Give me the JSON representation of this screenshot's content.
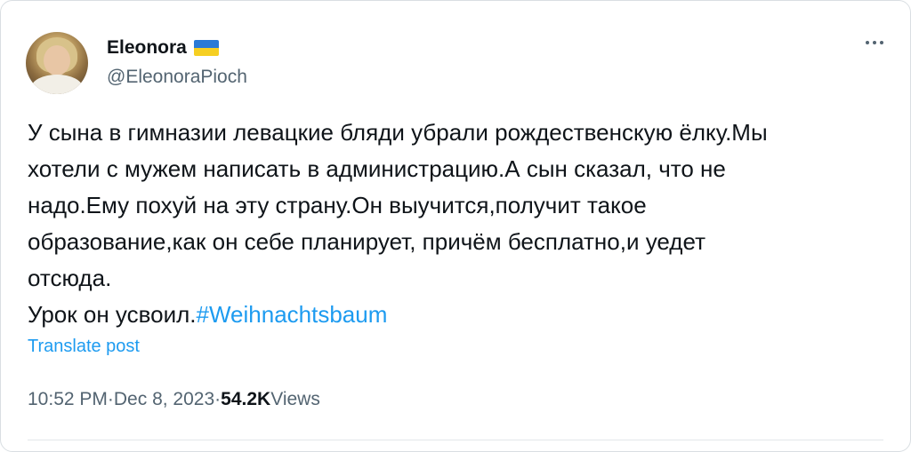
{
  "author": {
    "name": "Eleonora",
    "handle": "@EleonoraPioch",
    "flag_colors": [
      "#2a7ad6",
      "#f6cf22"
    ]
  },
  "tweet": {
    "text": "У сына в гимназии левацкие бляди убрали рождественскую ёлку.Мы\nхотели с мужем написать в администрацию.А сын сказал, что не\nнадо.Ему похуй на эту страну.Он выучится,получит такое\nобразование,как он себе планирует, причём бесплатно,и уедет\nотсюда.\nУрок он усвоил.",
    "hashtag": "#Weihnachtsbaum",
    "translate_label": "Translate post"
  },
  "meta": {
    "time": "10:52 PM",
    "separator": " · ",
    "date": "Dec 8, 2023",
    "views_count": "54.2K",
    "views_label": " Views"
  },
  "icons": {
    "more": "more-horizontal-icon",
    "flag": "ukraine-flag-icon"
  },
  "colors": {
    "text": "#0f1419",
    "secondary": "#536471",
    "link": "#1d9bf0"
  }
}
